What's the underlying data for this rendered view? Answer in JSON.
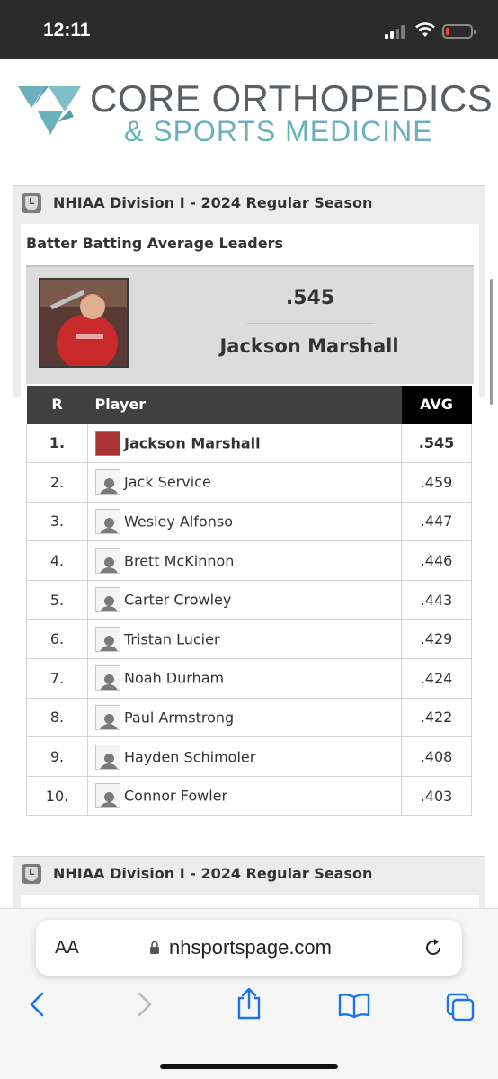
{
  "status": {
    "time": "12:11"
  },
  "header": {
    "logo_line1": "CORE ORTHOPEDICS",
    "logo_line2": "& SPORTS MEDICINE",
    "logo_color": "#6ab0bd"
  },
  "widget": {
    "title": "NHIAA Division I - 2024 Regular Season",
    "subtitle": "Batter Batting Average Leaders",
    "featured": {
      "value": ".545",
      "name": "Jackson Marshall"
    },
    "table": {
      "headers": {
        "rank": "R",
        "player": "Player",
        "avg": "AVG"
      },
      "rows": [
        {
          "rank": "1.",
          "player": "Jackson Marshall",
          "avg": ".545"
        },
        {
          "rank": "2.",
          "player": "Jack Service",
          "avg": ".459"
        },
        {
          "rank": "3.",
          "player": "Wesley Alfonso",
          "avg": ".447"
        },
        {
          "rank": "4.",
          "player": "Brett McKinnon",
          "avg": ".446"
        },
        {
          "rank": "5.",
          "player": "Carter Crowley",
          "avg": ".443"
        },
        {
          "rank": "6.",
          "player": "Tristan Lucier",
          "avg": ".429"
        },
        {
          "rank": "7.",
          "player": "Noah Durham",
          "avg": ".424"
        },
        {
          "rank": "8.",
          "player": "Paul Armstrong",
          "avg": ".422"
        },
        {
          "rank": "9.",
          "player": "Hayden Schimoler",
          "avg": ".408"
        },
        {
          "rank": "10.",
          "player": "Connor Fowler",
          "avg": ".403"
        }
      ]
    }
  },
  "widget2": {
    "title": "NHIAA Division I - 2024 Regular Season"
  },
  "browser": {
    "aa_label": "AA",
    "url": "nhsportspage.com"
  }
}
